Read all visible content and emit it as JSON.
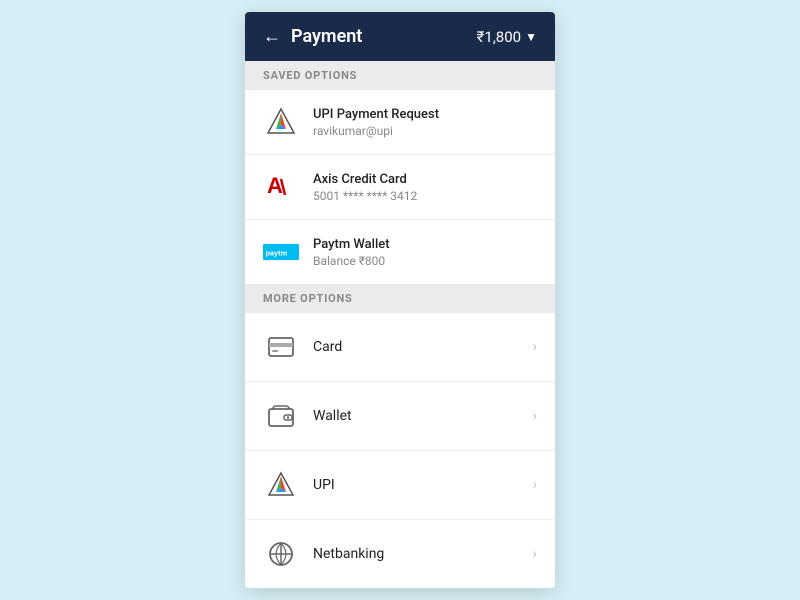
{
  "header": {
    "title": "Payment",
    "amount": "₹1,800",
    "back_label": "←"
  },
  "saved_section": {
    "label": "SAVED OPTIONS",
    "items": [
      {
        "title": "UPI Payment Request",
        "subtitle": "ravikumar@upi",
        "icon_type": "upi"
      },
      {
        "title": "Axis Credit Card",
        "subtitle": "5001 **** **** 3412",
        "icon_type": "axis"
      },
      {
        "title": "Paytm Wallet",
        "subtitle": "Balance  ₹800",
        "icon_type": "paytm"
      }
    ]
  },
  "more_section": {
    "label": "MORE OPTIONS",
    "items": [
      {
        "label": "Card",
        "icon_type": "card"
      },
      {
        "label": "Wallet",
        "icon_type": "wallet"
      },
      {
        "label": "UPI",
        "icon_type": "upi"
      },
      {
        "label": "Netbanking",
        "icon_type": "netbanking"
      }
    ]
  }
}
